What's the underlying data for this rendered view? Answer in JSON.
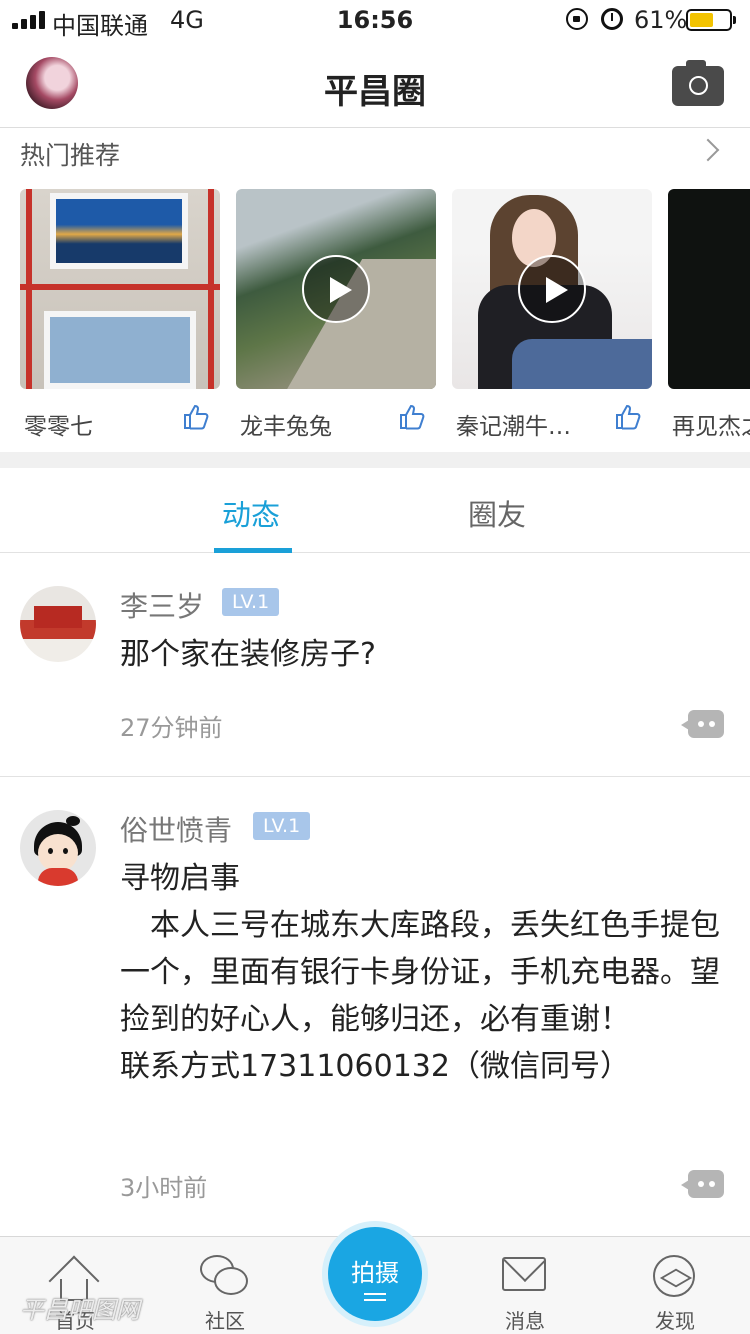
{
  "status_bar": {
    "carrier": "中国联通",
    "network": "4G",
    "time": "16:56",
    "battery_pct": "61%",
    "battery_level": 0.61,
    "battery_color": "#f3c300"
  },
  "header": {
    "title": "平昌圈"
  },
  "hot": {
    "label": "热门推荐",
    "cards": [
      {
        "name": "零零七",
        "video": false
      },
      {
        "name": "龙丰兔兔",
        "video": true
      },
      {
        "name": "秦记潮牛…",
        "video": true
      },
      {
        "name": "再见杰之",
        "video": false
      }
    ]
  },
  "tabs": {
    "items": [
      "动态",
      "圈友"
    ],
    "active": 0,
    "accent": "#1aa0d8"
  },
  "posts": [
    {
      "user": "李三岁",
      "level": "LV.1",
      "text": "那个家在装修房子?",
      "time": "27分钟前"
    },
    {
      "user": "俗世愤青",
      "level": "LV.1",
      "text": "寻物启事\n　本人三号在城东大库路段，丢失红色手提包 一个，里面有银行卡身份证，手机充电器。望捡到的好心人，能够归还，必有重谢！\n联系方式17311060132（微信同号）",
      "time": "3小时前"
    }
  ],
  "tabbar": {
    "home": "首页",
    "community": "社区",
    "shoot": "拍摄",
    "messages": "消息",
    "discover": "发现"
  },
  "watermark": "平昌吧图网"
}
